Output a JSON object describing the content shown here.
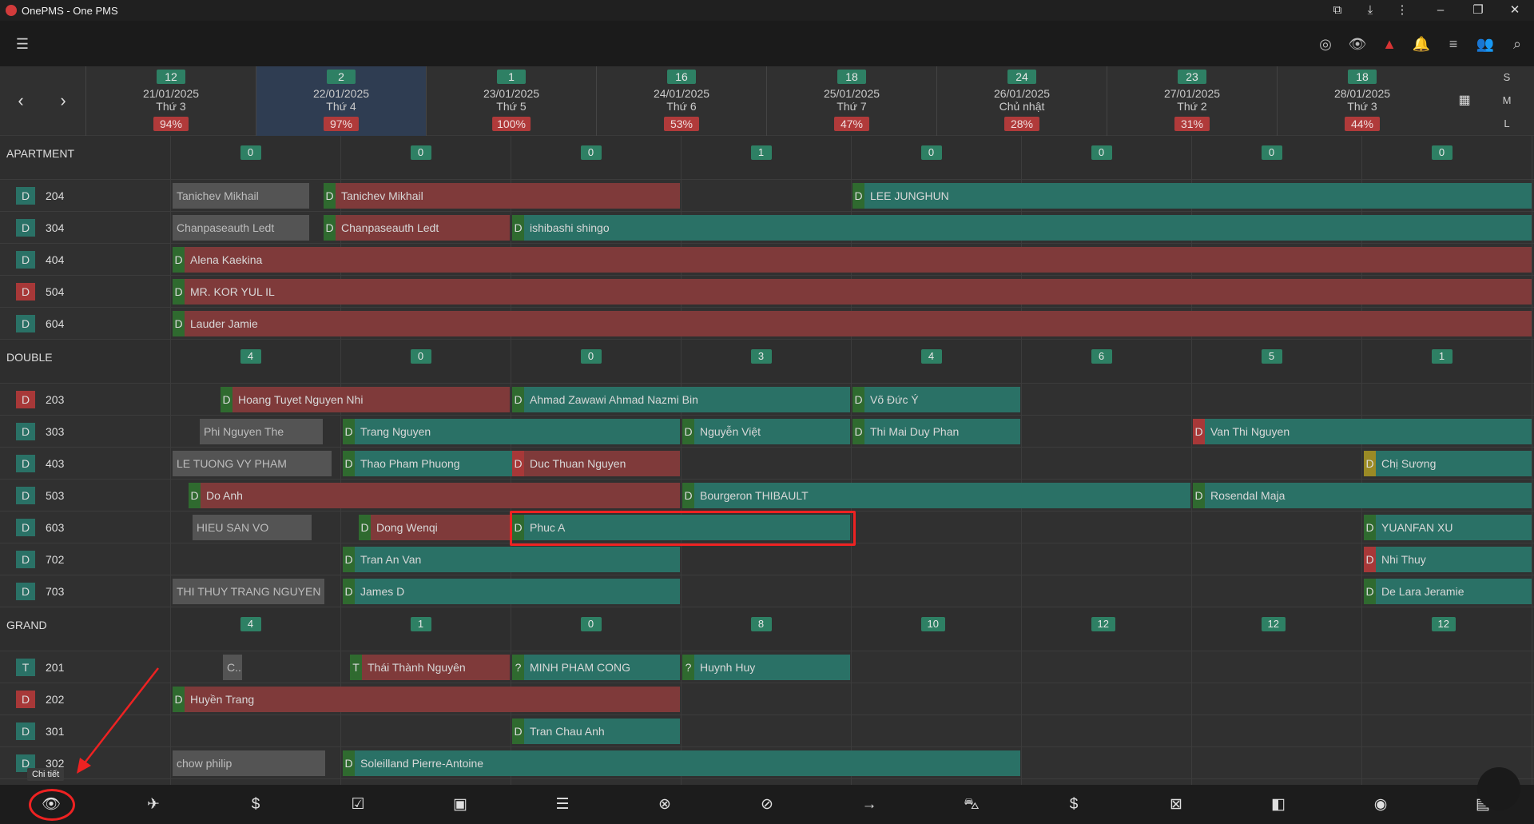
{
  "window": {
    "title": "OnePMS - One PMS"
  },
  "appbar": {
    "menu_icon": "hamburger-icon",
    "icons": [
      "fingerprint-icon",
      "eye-icon",
      "warning-icon",
      "bell-icon",
      "list-icon",
      "add-user-icon",
      "search-icon"
    ]
  },
  "calendar": {
    "days": [
      {
        "count": "12",
        "date": "21/01/2025",
        "weekday": "Thứ 3",
        "occ": "94%"
      },
      {
        "count": "2",
        "date": "22/01/2025",
        "weekday": "Thứ 4",
        "occ": "97%",
        "selected": true
      },
      {
        "count": "1",
        "date": "23/01/2025",
        "weekday": "Thứ 5",
        "occ": "100%"
      },
      {
        "count": "16",
        "date": "24/01/2025",
        "weekday": "Thứ 6",
        "occ": "53%"
      },
      {
        "count": "18",
        "date": "25/01/2025",
        "weekday": "Thứ 7",
        "occ": "47%"
      },
      {
        "count": "24",
        "date": "26/01/2025",
        "weekday": "Chủ nhật",
        "occ": "28%"
      },
      {
        "count": "23",
        "date": "27/01/2025",
        "weekday": "Thứ 2",
        "occ": "31%"
      },
      {
        "count": "18",
        "date": "28/01/2025",
        "weekday": "Thứ 3",
        "occ": "44%"
      }
    ],
    "sizes": [
      "S",
      "M",
      "L"
    ]
  },
  "groups": [
    {
      "name": "APARTMENT",
      "counts": [
        "0",
        "0",
        "0",
        "1",
        "0",
        "0",
        "0",
        "0"
      ]
    },
    {
      "name": "DOUBLE",
      "counts": [
        "4",
        "0",
        "0",
        "3",
        "4",
        "6",
        "5",
        "1"
      ]
    },
    {
      "name": "GRAND",
      "counts": [
        "4",
        "1",
        "0",
        "8",
        "10",
        "12",
        "12",
        "12"
      ]
    }
  ],
  "rooms": {
    "r204": {
      "no": "204",
      "st": "D"
    },
    "r304": {
      "no": "304",
      "st": "D"
    },
    "r404": {
      "no": "404",
      "st": "D"
    },
    "r504": {
      "no": "504",
      "st": "D"
    },
    "r604": {
      "no": "604",
      "st": "D"
    },
    "r203": {
      "no": "203",
      "st": "D"
    },
    "r303": {
      "no": "303",
      "st": "D"
    },
    "r403": {
      "no": "403",
      "st": "D"
    },
    "r503": {
      "no": "503",
      "st": "D"
    },
    "r603": {
      "no": "603",
      "st": "D"
    },
    "r702": {
      "no": "702",
      "st": "D"
    },
    "r703": {
      "no": "703",
      "st": "D"
    },
    "r201": {
      "no": "201",
      "st": "T"
    },
    "r202": {
      "no": "202",
      "st": "D"
    },
    "r301": {
      "no": "301",
      "st": "D"
    },
    "r302": {
      "no": "302",
      "st": "D"
    }
  },
  "bookings": {
    "b1": {
      "mk": "",
      "name": "Tanichev Mikhail"
    },
    "b2": {
      "mk": "D",
      "name": "Tanichev Mikhail"
    },
    "b3": {
      "mk": "D",
      "name": "LEE JUNGHUN"
    },
    "b4": {
      "mk": "",
      "name": "Chanpaseauth Ledt"
    },
    "b5": {
      "mk": "D",
      "name": "Chanpaseauth Ledt"
    },
    "b6": {
      "mk": "D",
      "name": "ishibashi shingo"
    },
    "b7": {
      "mk": "D",
      "name": "Alena Kaekina"
    },
    "b8": {
      "mk": "D",
      "name": "MR. KOR YUL IL"
    },
    "b9": {
      "mk": "D",
      "name": "Lauder Jamie"
    },
    "b10": {
      "mk": "D",
      "name": "Hoang Tuyet Nguyen Nhi"
    },
    "b11": {
      "mk": "D",
      "name": "Ahmad Zawawi Ahmad Nazmi Bin"
    },
    "b12": {
      "mk": "D",
      "name": "Võ Đức Ý"
    },
    "b13": {
      "mk": "",
      "name": "Phi Nguyen The"
    },
    "b14": {
      "mk": "D",
      "name": "Trang Nguyen"
    },
    "b15": {
      "mk": "D",
      "name": "Nguyễn Việt"
    },
    "b16": {
      "mk": "D",
      "name": "Thi Mai Duy Phan"
    },
    "b17": {
      "mk": "D",
      "name": "Van Thi Nguyen"
    },
    "b18": {
      "mk": "",
      "name": "LE TUONG VY PHAM"
    },
    "b19": {
      "mk": "D",
      "name": "Thao Pham Phuong"
    },
    "b20": {
      "mk": "D",
      "name": "Duc Thuan Nguyen"
    },
    "b21": {
      "mk": "D",
      "name": "Chị Sương"
    },
    "b22": {
      "mk": "D",
      "name": "Do Anh"
    },
    "b23": {
      "mk": "D",
      "name": "Bourgeron THIBAULT"
    },
    "b24": {
      "mk": "D",
      "name": "Rosendal Maja"
    },
    "b25": {
      "mk": "",
      "name": "HIEU SAN VO"
    },
    "b26": {
      "mk": "D",
      "name": "Dong Wenqi"
    },
    "b27": {
      "mk": "D",
      "name": "Phuc A"
    },
    "b28": {
      "mk": "D",
      "name": "YUANFAN XU"
    },
    "b29": {
      "mk": "D",
      "name": "Tran An Van"
    },
    "b30": {
      "mk": "D",
      "name": "Nhi Thuy"
    },
    "b31": {
      "mk": "",
      "name": "THI THUY TRANG NGUYEN"
    },
    "b32": {
      "mk": "D",
      "name": "James D"
    },
    "b33": {
      "mk": "D",
      "name": "De Lara Jeramie"
    },
    "b34": {
      "mk": "",
      "name": "C..."
    },
    "b35": {
      "mk": "T",
      "name": "Thái Thành Nguyên"
    },
    "b36": {
      "mk": "?",
      "name": "MINH PHAM CONG"
    },
    "b37": {
      "mk": "?",
      "name": "Huynh Huy"
    },
    "b38": {
      "mk": "D",
      "name": "Huyền Trang"
    },
    "b39": {
      "mk": "D",
      "name": "Tran Chau Anh"
    },
    "b40": {
      "mk": "",
      "name": "chow philip"
    },
    "b41": {
      "mk": "D",
      "name": "Soleilland Pierre-Antoine"
    }
  },
  "bottombar": {
    "tooltip": "Chi tiết",
    "icons": [
      "eye-icon",
      "departure-icon",
      "dollar-icon",
      "checklist-icon",
      "wallet-icon",
      "list-icon",
      "cancel-icon",
      "block-icon",
      "arrow-right-icon",
      "car-icon",
      "no-money-icon",
      "close-box-icon",
      "tag-icon",
      "user-circle-icon",
      "receipt-icon"
    ]
  },
  "colors": {
    "red": "#7f3a3a",
    "teal": "#2a7166",
    "gray": "#545454",
    "highlight": "#ee2222"
  }
}
